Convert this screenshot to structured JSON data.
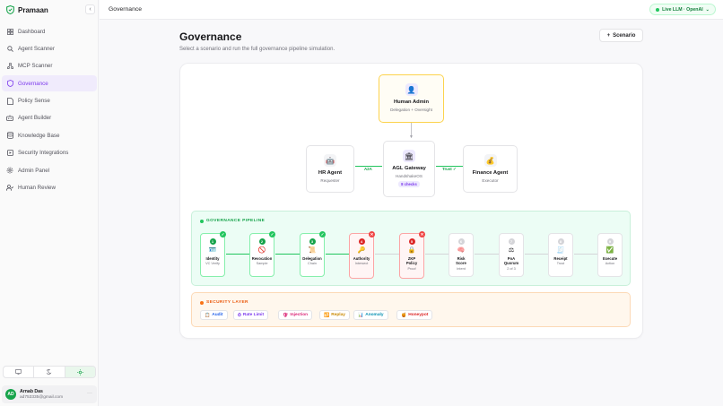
{
  "app": {
    "name": "Pramaan",
    "collapse_icon": "chevron-left-icon"
  },
  "sidebar": {
    "items": [
      {
        "label": "Dashboard",
        "icon": "grid-icon",
        "active": false
      },
      {
        "label": "Agent Scanner",
        "icon": "search-icon",
        "active": false
      },
      {
        "label": "MCP Scanner",
        "icon": "network-icon",
        "active": false
      },
      {
        "label": "Governance",
        "icon": "shield-icon",
        "active": true
      },
      {
        "label": "Policy Sense",
        "icon": "document-icon",
        "active": false
      },
      {
        "label": "Agent Builder",
        "icon": "bot-icon",
        "active": false
      },
      {
        "label": "Knowledge Base",
        "icon": "database-icon",
        "active": false
      },
      {
        "label": "Security Integrations",
        "icon": "plug-icon",
        "active": false
      },
      {
        "label": "Admin Panel",
        "icon": "gear-icon",
        "active": false
      },
      {
        "label": "Human Review",
        "icon": "user-check-icon",
        "active": false
      }
    ],
    "theme_options": [
      "monitor-icon",
      "moon-icon",
      "sun-icon"
    ],
    "user": {
      "initials": "AD",
      "name": "Arnab Das",
      "email": "ad753335@gmail.com"
    }
  },
  "header": {
    "title": "Governance",
    "status": "Live LLM · OpenAI",
    "status_color": "#22c55e"
  },
  "main": {
    "title": "Governance",
    "subtitle": "Select a scenario and run the full governance pipeline simulation.",
    "scenario_button": "Scenario"
  },
  "agents": {
    "admin": {
      "title": "Human Admin",
      "sub": "Delegation + Oversight",
      "icon": "person-icon"
    },
    "hr": {
      "title": "HR Agent",
      "sub": "Requester",
      "icon": "bot-icon"
    },
    "gateway": {
      "title": "AGL Gateway",
      "sub": "HandshakeOS",
      "badge": "8 checks",
      "icon": "bank-icon"
    },
    "finance": {
      "title": "Finance Agent",
      "sub": "Executor",
      "icon": "money-bag-icon"
    },
    "link_left": "A2A",
    "link_right": "Trust ✓"
  },
  "pipeline": {
    "title": "GOVERNANCE PIPELINE",
    "stages": [
      {
        "num": "1",
        "name": "Identity",
        "sub": "VC Verify",
        "status": "pass",
        "icon": "id-card-icon",
        "glyph": "🪪"
      },
      {
        "num": "2",
        "name": "Revocation",
        "sub": "Sample",
        "status": "pass",
        "icon": "prohibited-icon",
        "glyph": "🚫"
      },
      {
        "num": "3",
        "name": "Delegation",
        "sub": "Chain",
        "status": "pass",
        "icon": "scroll-icon",
        "glyph": "📜"
      },
      {
        "num": "4",
        "name": "Authority",
        "sub": "Intersect",
        "status": "fail",
        "icon": "key-icon",
        "glyph": "🔑"
      },
      {
        "num": "5",
        "name": "ZKP\nPolicy",
        "sub": "Proof",
        "status": "fail",
        "icon": "lock-icon",
        "glyph": "🔒"
      },
      {
        "num": "6",
        "name": "Risk\nScore",
        "sub": "Intent",
        "status": "pending",
        "icon": "brain-icon",
        "glyph": "🧠"
      },
      {
        "num": "7",
        "name": "PoA\nQuorum",
        "sub": "2 of 3",
        "status": "pending",
        "icon": "scales-icon",
        "glyph": "⚖"
      },
      {
        "num": "8",
        "name": "Receipt",
        "sub": "Trust",
        "status": "pending",
        "icon": "receipt-icon",
        "glyph": "🧾"
      },
      {
        "num": "9",
        "name": "Execute",
        "sub": "Action",
        "status": "pending",
        "icon": "check-box-icon",
        "glyph": "✅"
      }
    ]
  },
  "security": {
    "title": "SECURITY LAYER",
    "chips": [
      {
        "label": "Audit",
        "icon": "clipboard-icon",
        "glyph": "📋",
        "color": "#2563eb"
      },
      {
        "label": "Rate Limit",
        "icon": "stopwatch-icon",
        "glyph": "⏱",
        "color": "#7c3aed"
      },
      {
        "label": "Injection",
        "icon": "shield-icon",
        "glyph": "🛡",
        "color": "#db2777"
      },
      {
        "label": "Replay",
        "icon": "replay-icon",
        "glyph": "🔁",
        "color": "#ca8a04"
      },
      {
        "label": "Anomaly",
        "icon": "chart-icon",
        "glyph": "📊",
        "color": "#0891b2"
      },
      {
        "label": "Honeypot",
        "icon": "honey-pot-icon",
        "glyph": "🍯",
        "color": "#dc2626"
      }
    ]
  },
  "colors": {
    "accent": "#7c3aed",
    "pass": "#16a34a",
    "fail": "#dc2626",
    "pending": "#d4d4d8"
  }
}
